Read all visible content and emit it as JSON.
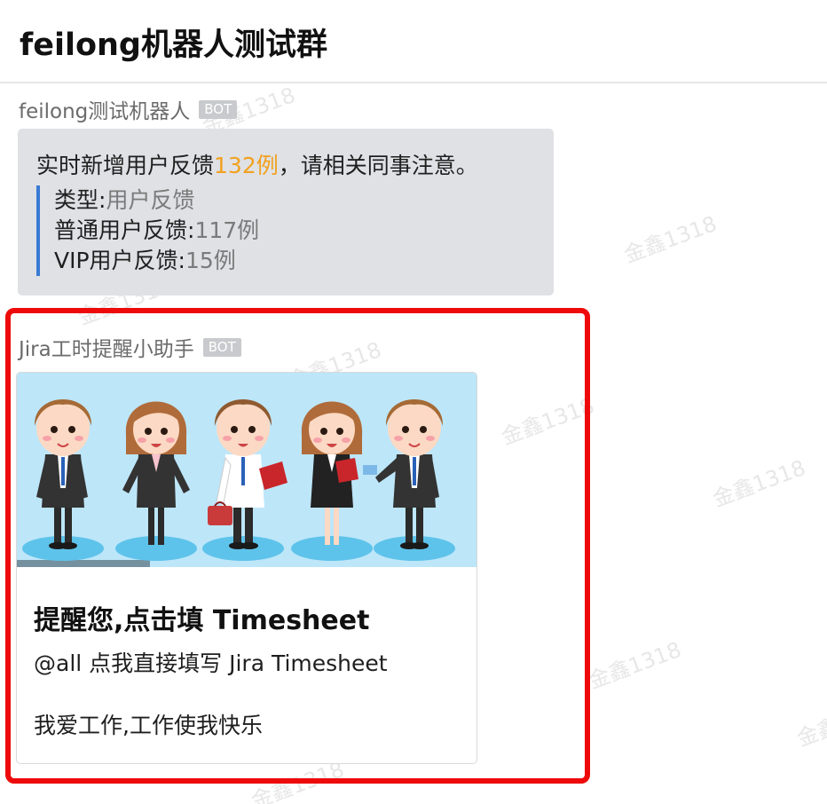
{
  "header": {
    "title": "feilong机器人测试群"
  },
  "messages": [
    {
      "sender": "feilong测试机器人",
      "badge": "BOT",
      "text_prefix": "实时新增用户反馈",
      "highlight": "132例",
      "text_suffix": "，请相关同事注意。",
      "quote": [
        {
          "label": "类型:",
          "value": "用户反馈"
        },
        {
          "label": "普通用户反馈:",
          "value": "117例"
        },
        {
          "label": "VIP用户反馈:",
          "value": "15例"
        }
      ]
    },
    {
      "sender": "Jira工时提醒小助手",
      "badge": "BOT",
      "card": {
        "title": "提醒您,点击填 Timesheet",
        "subtitle": "@all 点我直接填写 Jira Timesheet",
        "text": "我爱工作,工作使我快乐"
      }
    }
  ],
  "watermark": "金鑫1318",
  "colors": {
    "highlight": "#f2a01e",
    "quote_bar": "#3a7bd5",
    "bubble_bg": "#dfe1e5",
    "frame": "#ee0a0a",
    "image_bg": "#bde6f9"
  }
}
